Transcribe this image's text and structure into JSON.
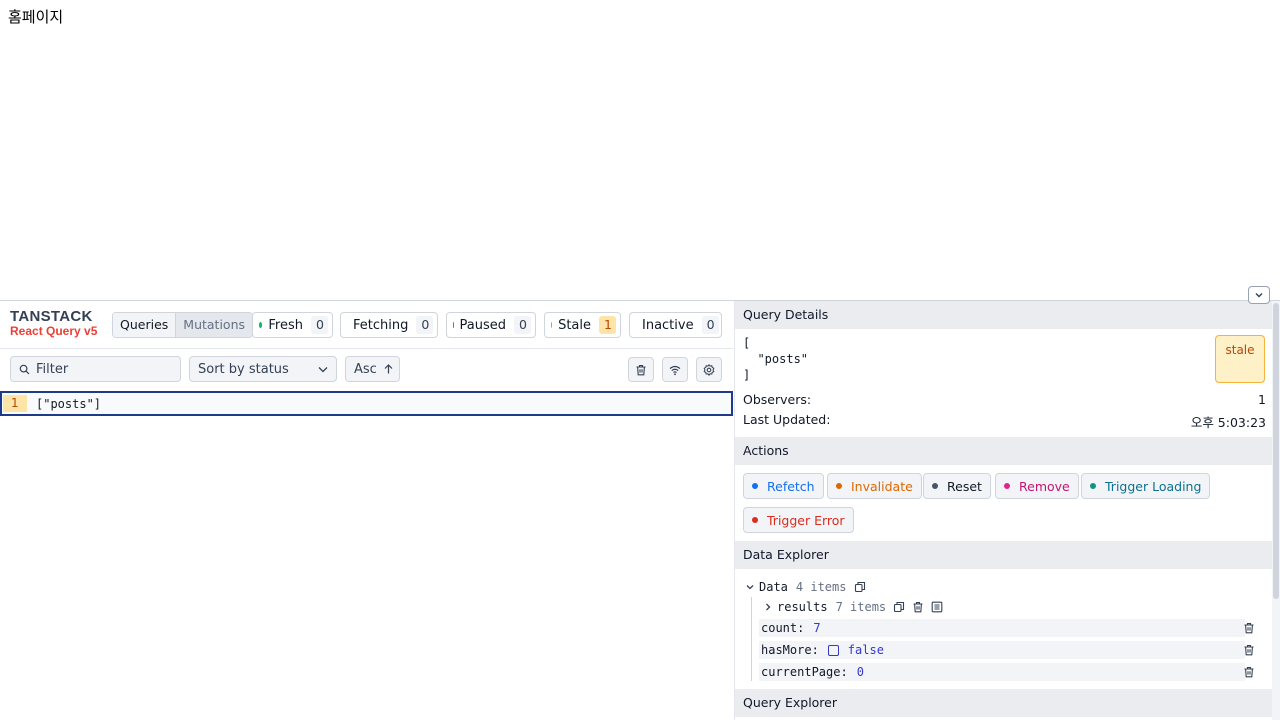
{
  "page": {
    "heading": "홈페이지"
  },
  "devtools": {
    "brand": {
      "name": "TANSTACK",
      "product": "React Query v5"
    },
    "view_toggle": {
      "queries": "Queries",
      "mutations": "Mutations"
    },
    "statuses": [
      {
        "label": "Fresh",
        "count": "0",
        "color": "#12b76a"
      },
      {
        "label": "Fetching",
        "count": "0",
        "color": "#2e90fa"
      },
      {
        "label": "Paused",
        "count": "0",
        "color": "#7a5af8"
      },
      {
        "label": "Stale",
        "count": "1",
        "color": "#f79009"
      },
      {
        "label": "Inactive",
        "count": "0",
        "color": "#667085"
      }
    ],
    "filter": {
      "placeholder": "Filter"
    },
    "sort": {
      "value": "Sort by status"
    },
    "order": {
      "label": "Asc"
    },
    "query_list": [
      {
        "observers": "1",
        "key": "[\"posts\"]"
      }
    ]
  },
  "details": {
    "title": "Query Details",
    "key_text": "[\n  \"posts\"\n]",
    "status_badge": "stale",
    "observers_label": "Observers:",
    "observers_value": "1",
    "last_updated_label": "Last Updated:",
    "last_updated_value": "오후 5:03:23"
  },
  "actions": {
    "title": "Actions",
    "buttons": [
      {
        "label": "Refetch",
        "color": "#1570ef"
      },
      {
        "label": "Invalidate",
        "color": "#dc6803"
      },
      {
        "label": "Reset",
        "color": "#475467"
      },
      {
        "label": "Remove",
        "color": "#dd2590"
      },
      {
        "label": "Trigger Loading",
        "color": "#0e9384"
      },
      {
        "label": "Trigger Error",
        "color": "#d92d20"
      }
    ]
  },
  "data_explorer": {
    "title": "Data Explorer",
    "root": {
      "label": "Data",
      "meta": "4 items"
    },
    "results": {
      "label": "results",
      "meta": "7 items"
    },
    "props": [
      {
        "key": "count:",
        "value": "7"
      },
      {
        "key": "hasMore:",
        "value": "false"
      },
      {
        "key": "currentPage:",
        "value": "0"
      }
    ]
  },
  "query_explorer": {
    "title": "Query Explorer"
  }
}
